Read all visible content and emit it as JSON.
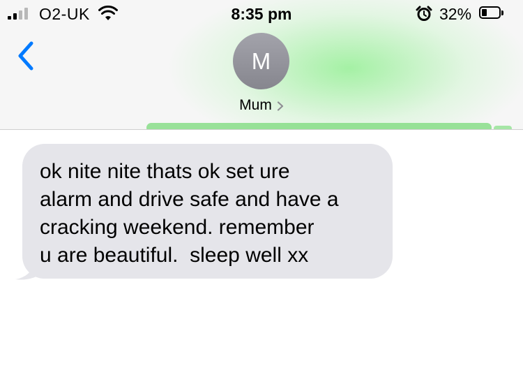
{
  "status_bar": {
    "carrier": "O2-UK",
    "time": "8:35 pm",
    "battery_percent": "32%",
    "battery_level": 0.32,
    "signal_bars_active": 2,
    "signal_bars_total": 4,
    "icons": [
      "cellular-signal-icon",
      "wifi-icon",
      "alarm-clock-icon",
      "battery-icon"
    ]
  },
  "header": {
    "back_icon": "chevron-left-icon",
    "avatar_initial": "M",
    "contact_name": "Mum",
    "detail_icon": "chevron-right-icon"
  },
  "messages": [
    {
      "direction": "incoming",
      "text": "ok nite nite thats ok set ure\nalarm and drive safe and have a\ncracking weekend. remember\nu are beautiful.  sleep well xx"
    }
  ],
  "colors": {
    "accent": "#007aff",
    "incoming_bubble": "#e5e5ea",
    "avatar": "#8e8e93",
    "header_background": "#f6f6f6",
    "outgoing_glow": "#79d97a"
  }
}
